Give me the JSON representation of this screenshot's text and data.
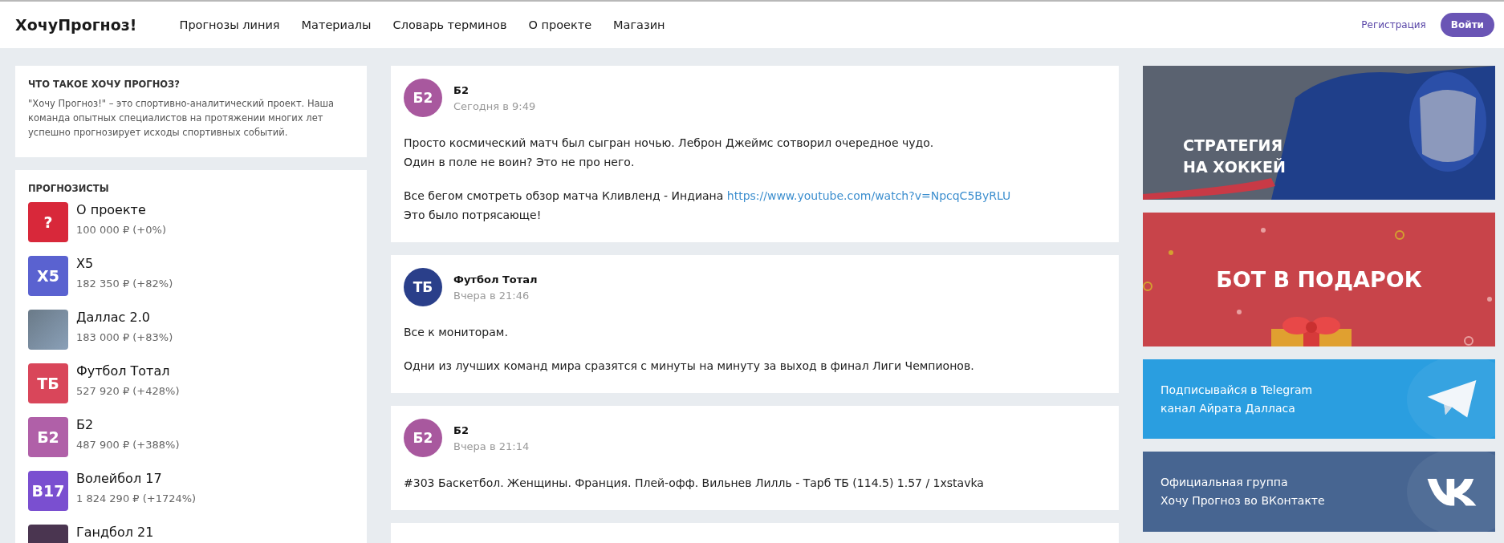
{
  "header": {
    "logo": "ХочуПрогноз!",
    "nav": [
      "Прогнозы линия",
      "Материалы",
      "Словарь терминов",
      "О проекте",
      "Магазин"
    ],
    "register": "Регистрация",
    "login": "Войти"
  },
  "about": {
    "title": "ЧТО ТАКОЕ ХОЧУ ПРОГНОЗ?",
    "text": "\"Хочу Прогноз!\" – это спортивно-аналитический проект. Наша команда опытных специалистов на протяжении многих лет успешно прогнозирует исходы спортивных событий."
  },
  "forecasters": {
    "title": "ПРОГНОЗИСТЫ",
    "items": [
      {
        "kind": "letters",
        "avatar": "?",
        "color": "#d8283a",
        "name": "О проекте",
        "balance": "100 000 ₽ (+0%)"
      },
      {
        "kind": "letters",
        "avatar": "Х5",
        "color": "#5a62d0",
        "name": "Х5",
        "balance": "182 350 ₽ (+82%)"
      },
      {
        "kind": "photo",
        "name": "Даллас 2.0",
        "balance": "183 000 ₽ (+83%)"
      },
      {
        "kind": "letters",
        "avatar": "ТБ",
        "color": "#d9465a",
        "name": "Футбол Тотал",
        "balance": "527 920 ₽ (+428%)"
      },
      {
        "kind": "letters",
        "avatar": "Б2",
        "color": "#b060a8",
        "name": "Б2",
        "balance": "487 900 ₽ (+388%)"
      },
      {
        "kind": "letters",
        "avatar": "В17",
        "color": "#7a4fd0",
        "name": "Волейбол 17",
        "balance": "1 824 290 ₽ (+1724%)"
      },
      {
        "kind": "letters",
        "color": "#4a3550",
        "name": "Гандбол 21"
      }
    ]
  },
  "posts": [
    {
      "avatar": "Б2",
      "color": "#a8589e",
      "author": "Б2",
      "time": "Сегодня в 9:49",
      "paragraphs": [
        [
          {
            "text": "Просто космический матч был сыгран ночью. Леброн Джеймс сотворил очередное чудо."
          },
          {
            "text": "Один в поле не воин? Это не про него."
          }
        ],
        [
          {
            "text": "Все бегом смотреть обзор матча Кливленд - Индиана ",
            "link": "https://www.youtube.com/watch?v=NpcqC5ByRLU"
          },
          {
            "text": "Это было потрясающе!"
          }
        ]
      ]
    },
    {
      "avatar": "ТБ",
      "color": "#2a3f8a",
      "author": "Футбол Тотал",
      "time": "Вчера в 21:46",
      "paragraphs": [
        [
          {
            "text": "Все к мониторам."
          }
        ],
        [
          {
            "text": "Одни из лучших команд мира сразятся с минуты на минуту за выход в финал Лиги Чемпионов."
          }
        ]
      ]
    },
    {
      "avatar": "Б2",
      "color": "#a8589e",
      "author": "Б2",
      "time": "Вчера в 21:14",
      "paragraphs": [
        [
          {
            "text": "#303 Баскетбол. Женщины. Франция. Плей-офф. Вильнев Лилль - Тарб ТБ (114.5) 1.57 / 1xstavka"
          }
        ]
      ]
    }
  ],
  "banners": [
    {
      "kind": "hockey",
      "lines": [
        "СТРАТЕГИЯ",
        "НА ХОККЕЙ"
      ]
    },
    {
      "kind": "gift",
      "lines": [
        "БОТ В ПОДАРОК"
      ]
    },
    {
      "kind": "telegram",
      "lines": [
        "Подписывайся в Telegram",
        "канал Айрата Далласа"
      ]
    },
    {
      "kind": "vk",
      "lines": [
        "Официальная группа",
        "Хочу Прогноз во ВКонтакте"
      ]
    }
  ]
}
